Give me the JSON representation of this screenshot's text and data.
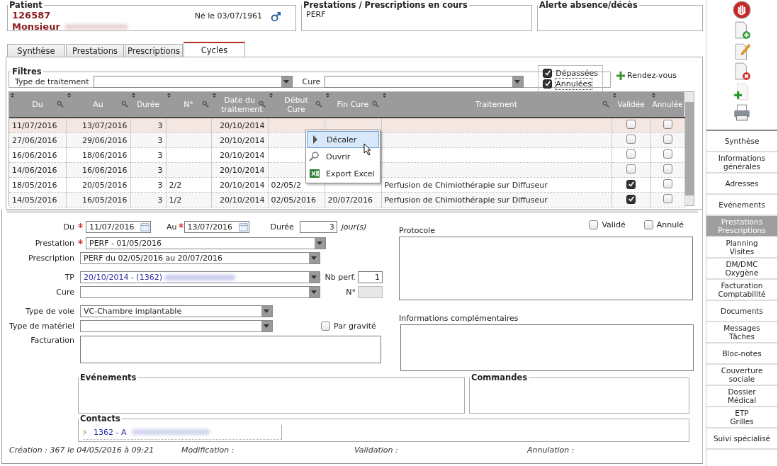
{
  "patient": {
    "legend": "Patient",
    "id": "126587",
    "title": "Monsieur",
    "birth": "Né le 03/07/1961"
  },
  "prestations_panel": {
    "legend": "Prestations / Prescriptions en cours",
    "content": "PERF"
  },
  "alert_panel": {
    "legend": "Alerte absence/décès"
  },
  "tabs": [
    {
      "label": "Synthèse",
      "selected": false
    },
    {
      "label": "Prestations",
      "selected": false
    },
    {
      "label": "Prescriptions",
      "selected": false
    },
    {
      "label": "Cycles",
      "selected": true
    }
  ],
  "filters": {
    "legend": "Filtres",
    "type_label": "Type de traitement",
    "cure_label": "Cure",
    "options": [
      {
        "label": "Dépassées",
        "checked": true,
        "focused": false
      },
      {
        "label": "Annulées",
        "checked": true,
        "focused": true
      }
    ],
    "appointment_button": "Rendez-vous"
  },
  "table": {
    "columns": [
      {
        "label": "Du",
        "searchable": true
      },
      {
        "label": "Au",
        "searchable": true
      },
      {
        "label": "Durée",
        "searchable": false
      },
      {
        "label": "N°",
        "searchable": true
      },
      {
        "label": "Date du traitement",
        "searchable": true
      },
      {
        "label": "Début Cure",
        "searchable": true
      },
      {
        "label": "Fin Cure",
        "searchable": true
      },
      {
        "label": "Traitement",
        "searchable": true
      },
      {
        "label": "Validée",
        "searchable": false
      },
      {
        "label": "Annulée",
        "searchable": false
      }
    ],
    "rows": [
      {
        "cells": [
          "11/07/2016",
          "13/07/2016",
          "3",
          null,
          "20/10/2014",
          null,
          null,
          null
        ],
        "validated": false,
        "cancelled": false,
        "selected": true
      },
      {
        "cells": [
          "27/06/2016",
          "29/06/2016",
          "3",
          null,
          "20/10/2014",
          null,
          null,
          null
        ],
        "validated": false,
        "cancelled": false,
        "selected": false
      },
      {
        "cells": [
          "16/06/2016",
          "18/06/2016",
          "3",
          null,
          "20/10/2014",
          null,
          null,
          null
        ],
        "validated": false,
        "cancelled": false,
        "selected": false
      },
      {
        "cells": [
          "14/06/2016",
          "16/06/2016",
          "3",
          null,
          "20/10/2014",
          null,
          null,
          null
        ],
        "validated": false,
        "cancelled": false,
        "selected": false
      },
      {
        "cells": [
          "18/05/2016",
          "20/05/2016",
          "3",
          "2/2",
          "20/10/2014",
          "02/05/2",
          null,
          "Perfusion de Chimiothérapie sur Diffuseur"
        ],
        "validated": true,
        "cancelled": false,
        "selected": false
      },
      {
        "cells": [
          "14/05/2016",
          "16/05/2016",
          "3",
          "1/2",
          "20/10/2014",
          "02/05/2016",
          "20/07/2016",
          "Perfusion de Chimiothérapie sur Diffuseur"
        ],
        "validated": true,
        "cancelled": false,
        "selected": false
      }
    ]
  },
  "context_menu": {
    "items": [
      {
        "kind": "shift",
        "label": "Décaler",
        "selected": true
      },
      {
        "kind": "open",
        "label": "Ouvrir",
        "selected": false
      },
      {
        "kind": "excel",
        "label": "Export Excel",
        "selected": false
      }
    ]
  },
  "detail": {
    "du": {
      "label": "Du",
      "required": true,
      "value": "11/07/2016"
    },
    "au": {
      "label": "Au",
      "required": true,
      "value": "13/07/2016"
    },
    "duree": {
      "label": "Durée",
      "value": "3",
      "unit": "jour(s)"
    },
    "prestation": {
      "label": "Prestation",
      "required": true,
      "value": "PERF - 01/05/2016"
    },
    "prescription": {
      "label": "Prescription",
      "required": false,
      "value": "PERF du 02/05/2016 au 20/07/2016"
    },
    "tp": {
      "label": "TP",
      "value": "20/10/2014 - (1362)"
    },
    "nb_perf": {
      "label": "Nb perf.",
      "value": "1"
    },
    "cure": {
      "label": "Cure"
    },
    "numero": {
      "label": "N°",
      "disabled": true
    },
    "type_voie": {
      "label": "Type de voie",
      "value": "VC-Chambre implantable"
    },
    "type_materiel": {
      "label": "Type de matériel"
    },
    "par_gravite": {
      "label": "Par gravité",
      "checked": false
    },
    "facturation": {
      "label": "Facturation"
    },
    "valide": {
      "label": "Validé",
      "checked": false
    },
    "annule": {
      "label": "Annulé",
      "checked": false
    },
    "protocole": {
      "label": "Protocole"
    },
    "infos": {
      "label": "Informations complémentaires"
    },
    "evenements": {
      "legend": "Evénements"
    },
    "commandes": {
      "legend": "Commandes"
    },
    "contacts": {
      "legend": "Contacts",
      "items": [
        {
          "text": "1362 - A",
          "expanded": false
        }
      ]
    }
  },
  "footer": [
    "Création : 367 le 04/05/2016 à 09:21",
    "Modification :",
    "Validation :",
    "Annulation :"
  ],
  "sidebar": {
    "items": [
      {
        "lines": [
          "Synthèse"
        ],
        "selected": false
      },
      {
        "lines": [
          "Informations",
          "générales"
        ],
        "selected": false
      },
      {
        "lines": [
          "Adresses"
        ],
        "selected": false
      },
      {
        "lines": [
          "Evénements"
        ],
        "selected": false
      },
      {
        "lines": [
          "Prestations",
          "Prescriptions"
        ],
        "selected": true
      },
      {
        "lines": [
          "Planning",
          "Visites"
        ],
        "selected": false
      },
      {
        "lines": [
          "DM/DMC",
          "Oxygène"
        ],
        "selected": false
      },
      {
        "lines": [
          "Facturation",
          "Comptabilité"
        ],
        "selected": false
      },
      {
        "lines": [
          "Documents"
        ],
        "selected": false
      },
      {
        "lines": [
          "Messages",
          "Tâches"
        ],
        "selected": false
      },
      {
        "lines": [
          "Bloc-notes"
        ],
        "selected": false
      },
      {
        "lines": [
          "Couverture",
          "sociale"
        ],
        "selected": false
      },
      {
        "lines": [
          "Dossier",
          "Médical"
        ],
        "selected": false
      },
      {
        "lines": [
          "ETP",
          "Grilles"
        ],
        "selected": false
      },
      {
        "lines": [
          "Suivi spécialisé"
        ],
        "selected": false
      }
    ]
  }
}
